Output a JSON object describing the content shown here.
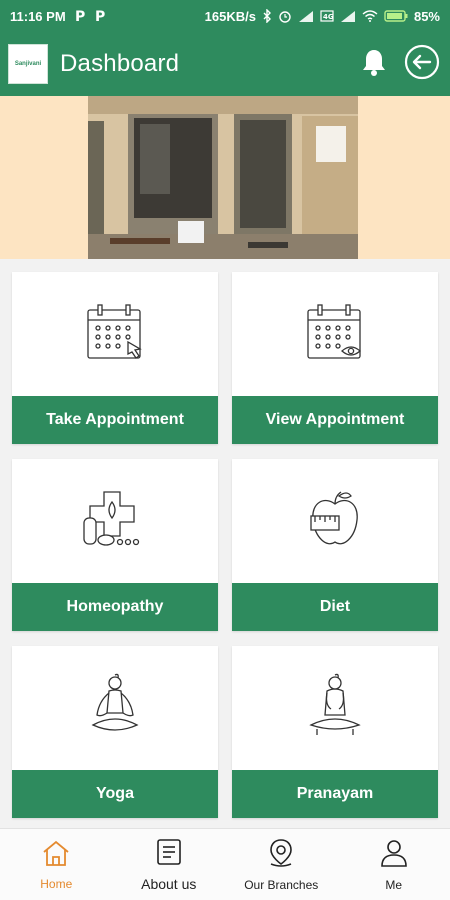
{
  "status": {
    "time": "11:16 PM",
    "speed": "165KB/s",
    "battery": "85%"
  },
  "appbar": {
    "logo_text": "Sanjivani",
    "title": "Dashboard"
  },
  "cards": [
    {
      "label": "Take Appointment",
      "icon": "calendar-touch-icon"
    },
    {
      "label": "View Appointment",
      "icon": "calendar-eye-icon"
    },
    {
      "label": "Homeopathy",
      "icon": "homeopathy-icon"
    },
    {
      "label": "Diet",
      "icon": "apple-tape-icon"
    },
    {
      "label": "Yoga",
      "icon": "yoga-icon"
    },
    {
      "label": "Pranayam",
      "icon": "pranayam-icon"
    }
  ],
  "bottom_nav": [
    {
      "label": "Home",
      "icon": "home-icon",
      "active": true
    },
    {
      "label": "About us",
      "icon": "document-icon",
      "active": false
    },
    {
      "label": "Our Branches",
      "icon": "location-pin-icon",
      "active": false
    },
    {
      "label": "Me",
      "icon": "user-icon",
      "active": false
    }
  ],
  "colors": {
    "primary": "#2e8b5e",
    "hero_bg": "#fde4c2",
    "active_nav": "#e48a2f"
  }
}
